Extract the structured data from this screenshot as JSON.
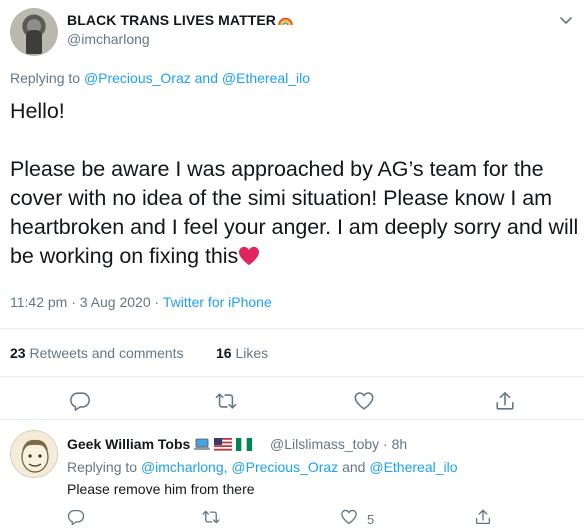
{
  "tweet": {
    "display_name": "BLACK TRANS LIVES MATTER",
    "name_emoji": "rainbow-icon",
    "handle": "@imcharlong",
    "replying_prefix": "Replying to",
    "replying_to_1": "@Precious_Oraz",
    "replying_and": "and",
    "replying_to_2": "@Ethereal_ilo",
    "body_line1": "Hello!",
    "body_paragraph2": "Please be aware I was approached by AG’s team for the cover with no idea of the simi situation! Please know I am heartbroken and I feel your anger. I am deeply sorry and will be working on fixing this",
    "body_emoji": "red-heart-icon",
    "time": "11:42 pm · 3 Aug 2020 · ",
    "source": "Twitter for iPhone",
    "retweets_count": "23",
    "retweets_label": "Retweets and comments",
    "likes_count": "16",
    "likes_label": "Likes"
  },
  "reply": {
    "display_name": "Geek William Tobs",
    "name_emojis": [
      "laptop-icon",
      "us-flag-icon",
      "nigeria-flag-icon"
    ],
    "handle": "@Lilslimass_toby · 8h",
    "replying_prefix": "Replying to",
    "replying_to_1": "@imcharlong,",
    "replying_to_2": "@Precious_Oraz",
    "replying_and": "and",
    "replying_to_3": "@Ethereal_ilo",
    "text": "Please remove him from there",
    "like_count": "5"
  },
  "colors": {
    "link": "#1da1f2",
    "secondary": "#657786",
    "primary_text": "#14171a",
    "divider": "#e6ecf0",
    "icon": "#657786",
    "heart": "#e0245e"
  }
}
